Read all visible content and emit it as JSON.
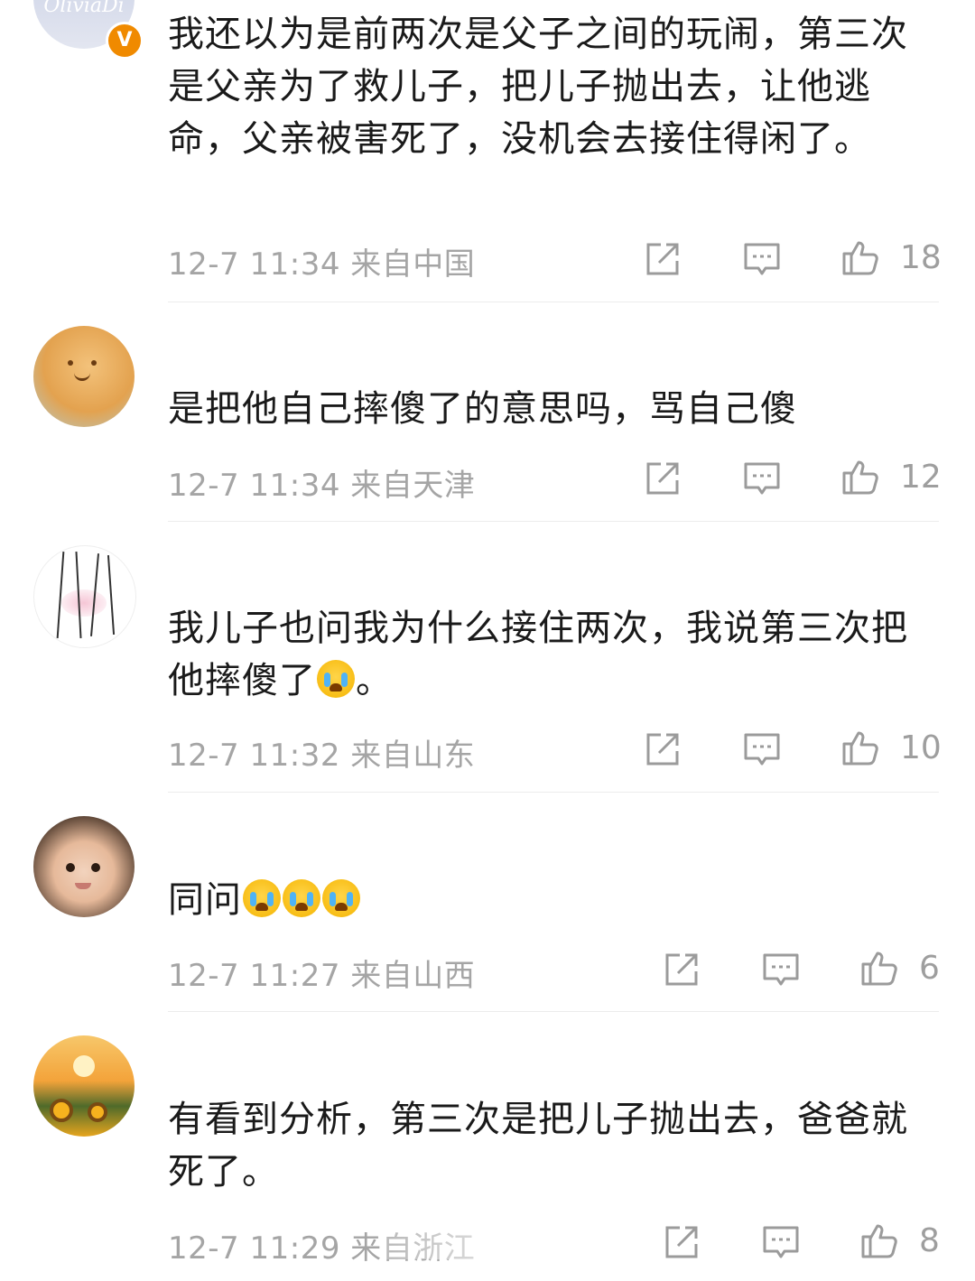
{
  "comments": [
    {
      "text": "我还以为是前两次是父子之间的玩闹，第三次是父亲为了救儿子，把儿子抛出去，让他逃命，父亲被害死了，没机会去接住得闲了。",
      "meta": "12-7 11:34 来自中国",
      "likes": "18",
      "avatar_text": "OliviaDi",
      "verified_badge": "V"
    },
    {
      "text": "是把他自己摔傻了的意思吗，骂自己傻",
      "meta": "12-7 11:34 来自天津",
      "likes": "12"
    },
    {
      "text": "我儿子也问我为什么接住两次，我说第三次把他摔傻了",
      "text_tail": "。",
      "meta": "12-7 11:32 来自山东",
      "likes": "10"
    },
    {
      "text": "同问",
      "meta": "12-7 11:27 来自山西",
      "likes": "6"
    },
    {
      "text": "有看到分析，第三次是把儿子抛出去，爸爸就死了。",
      "meta": "12-7 11:29 来自浙江",
      "likes": "8"
    }
  ],
  "icons": {
    "share": "share-icon",
    "reply": "comment-icon",
    "like": "thumbs-up-icon",
    "crying": "crying-emoji-icon"
  },
  "colors": {
    "text": "#1a1a1a",
    "meta": "#a5a5a5",
    "badge": "#f08a00"
  }
}
